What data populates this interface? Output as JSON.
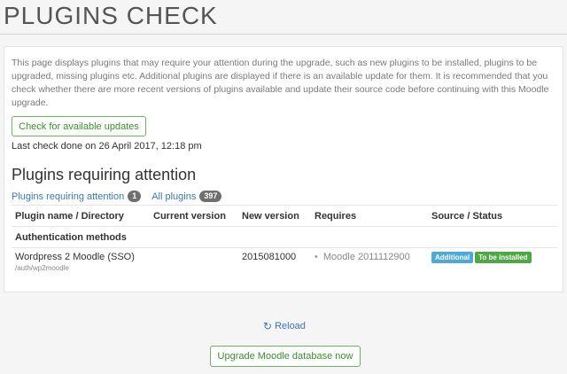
{
  "page": {
    "title": "PLUGINS CHECK"
  },
  "intro": "This page displays plugins that may require your attention during the upgrade, such as new plugins to be installed, plugins to be upgraded, missing plugins etc. Additional plugins are displayed if there is an available update for them. It is recommended that you check whether there are more recent versions of plugins available and update their source code before continuing with this Moodle upgrade.",
  "check_button": "Check for available updates",
  "last_check": "Last check done on 26 April 2017, 12:18 pm",
  "section_title": "Plugins requiring attention",
  "filters": [
    {
      "label": "Plugins requiring attention",
      "count": "1"
    },
    {
      "label": "All plugins",
      "count": "397"
    }
  ],
  "table": {
    "headers": [
      "Plugin name / Directory",
      "Current version",
      "New version",
      "Requires",
      "Source / Status"
    ],
    "group": "Authentication methods",
    "row": {
      "name": "Wordpress 2 Moodle (SSO)",
      "dir": "/auth/wp2moodle",
      "current": "",
      "new": "2015081000",
      "requires": "Moodle 2011112900",
      "source_label": "Additional",
      "status_label": "To be installed"
    }
  },
  "reload": "Reload",
  "upgrade_button": "Upgrade Moodle database now",
  "colors": {
    "accent_green": "#6cb35f",
    "link_blue": "#3b76b8",
    "info_label": "#4fa9d8",
    "success_label": "#4ea845"
  }
}
